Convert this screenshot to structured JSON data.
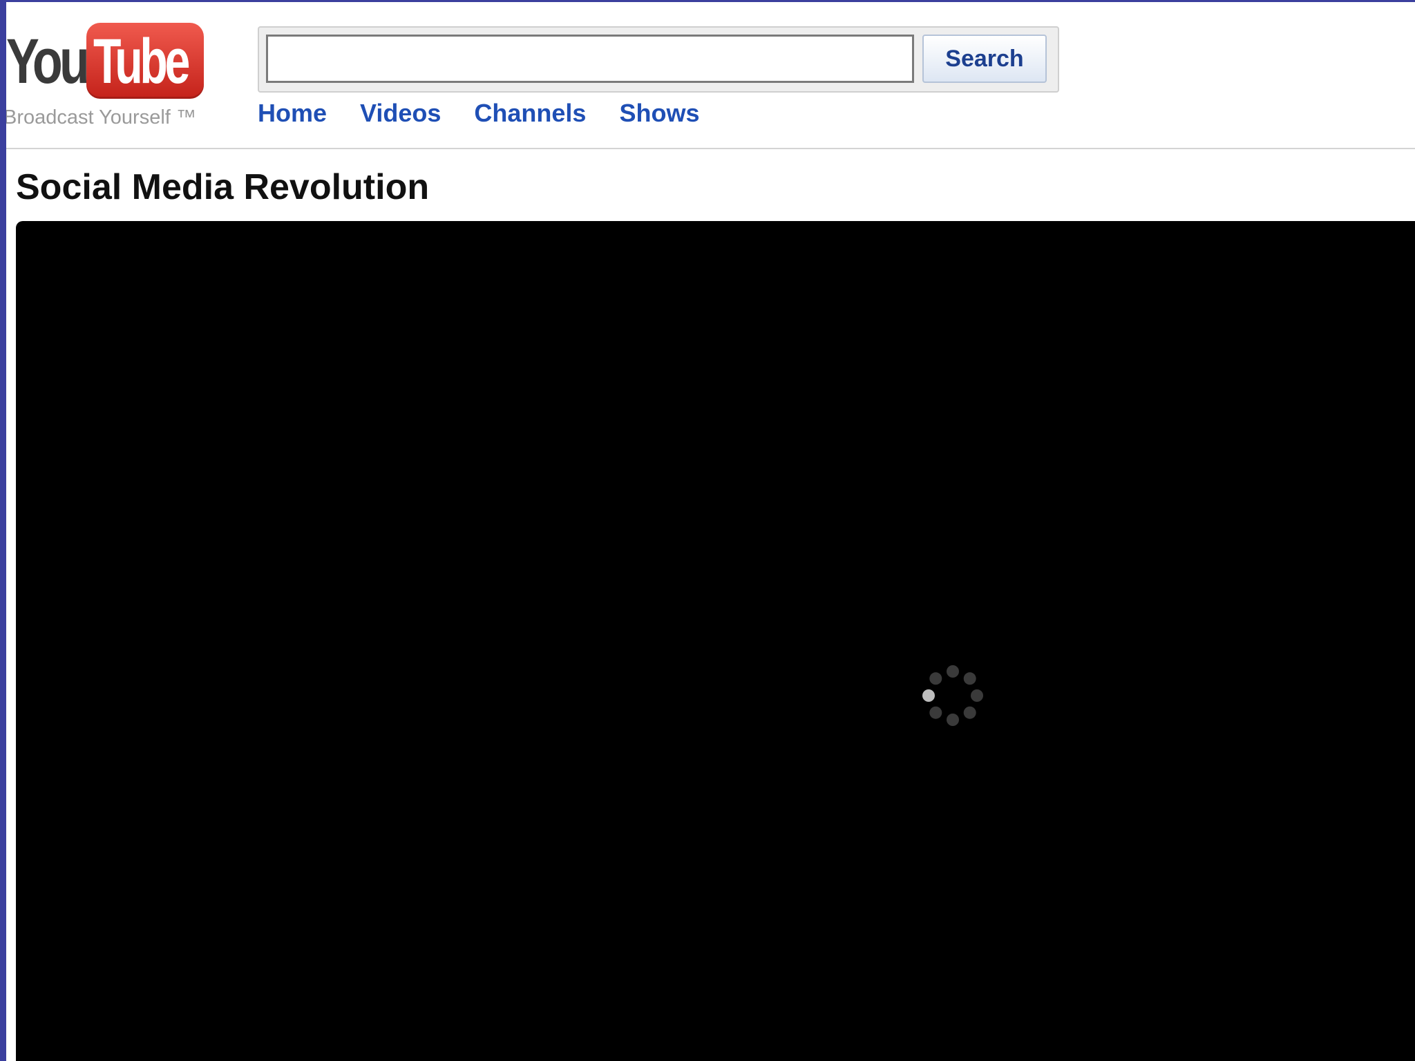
{
  "logo": {
    "part1": "You",
    "part2": "Tube",
    "tagline": "Broadcast Yourself ™"
  },
  "search": {
    "value": "",
    "placeholder": "",
    "button_label": "Search"
  },
  "nav": {
    "items": [
      "Home",
      "Videos",
      "Channels",
      "Shows"
    ]
  },
  "video": {
    "title": "Social Media Revolution",
    "state": "loading"
  },
  "colors": {
    "link": "#1f4fb5",
    "logo_red": "#d8352b",
    "player_bg": "#000000"
  }
}
